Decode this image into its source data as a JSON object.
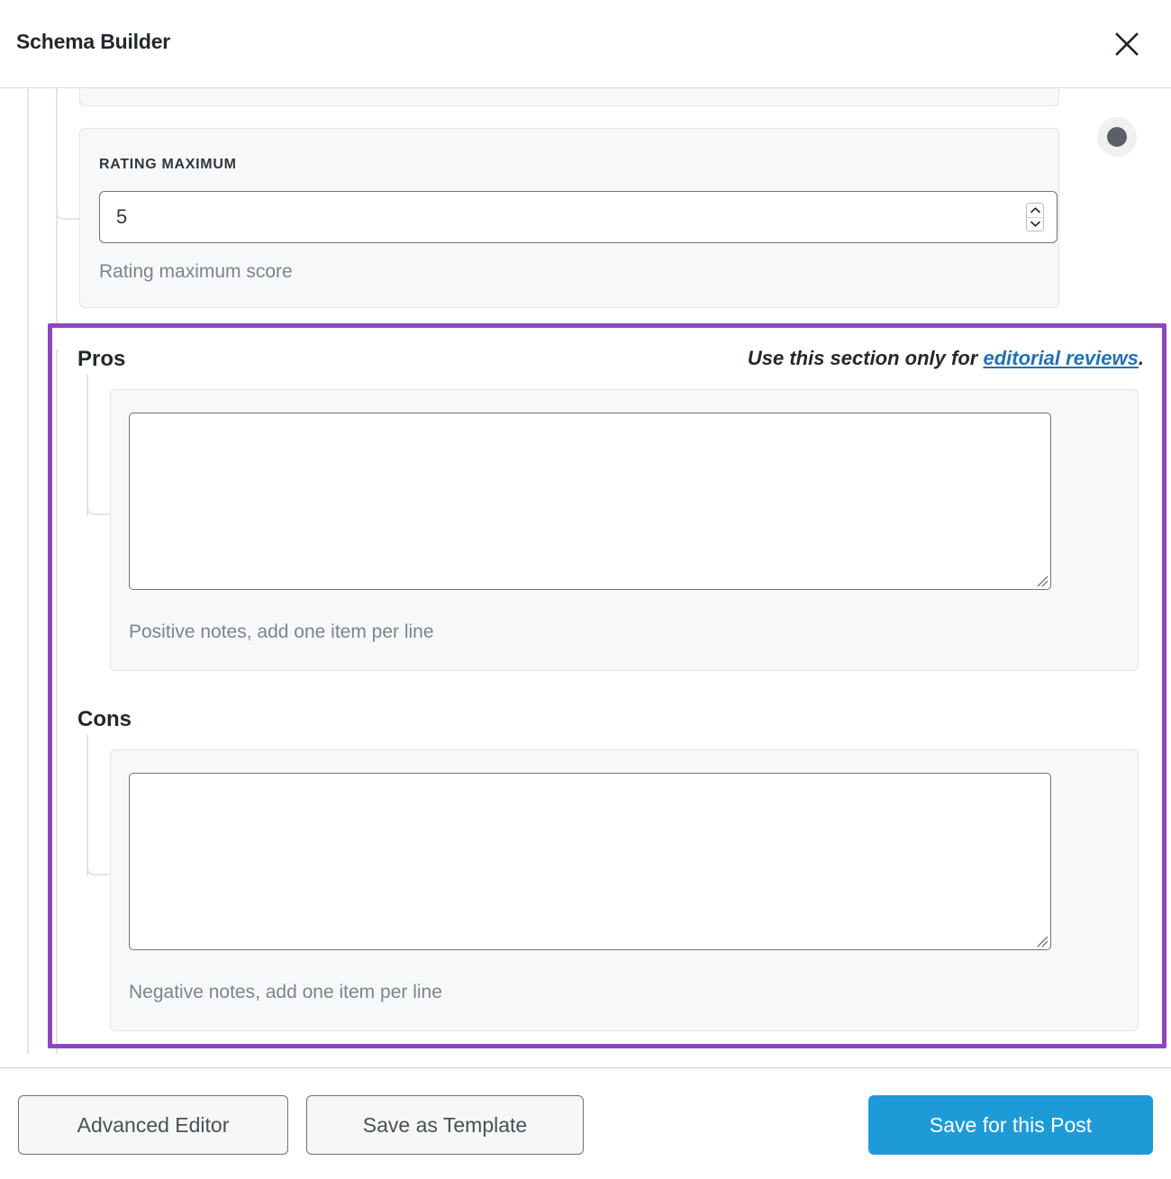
{
  "header": {
    "title": "Schema Builder",
    "close_label": "×"
  },
  "fields": {
    "rating_maximum": {
      "label": "RATING MAXIMUM",
      "value": "5",
      "help": "Rating maximum score"
    },
    "pros": {
      "title": "Pros",
      "note_prefix": "Use this section only for ",
      "note_link": "editorial reviews",
      "note_suffix": ".",
      "value": "",
      "placeholder": "",
      "help": "Positive notes, add one item per line"
    },
    "cons": {
      "title": "Cons",
      "value": "",
      "placeholder": "",
      "help": "Negative notes, add one item per line"
    }
  },
  "footer": {
    "advanced_editor": "Advanced Editor",
    "save_as_template": "Save as Template",
    "save_for_this_post": "Save for this Post"
  },
  "colors": {
    "highlight": "#8b47c0",
    "primary_button": "#1e9bd7",
    "link": "#2271b1"
  }
}
